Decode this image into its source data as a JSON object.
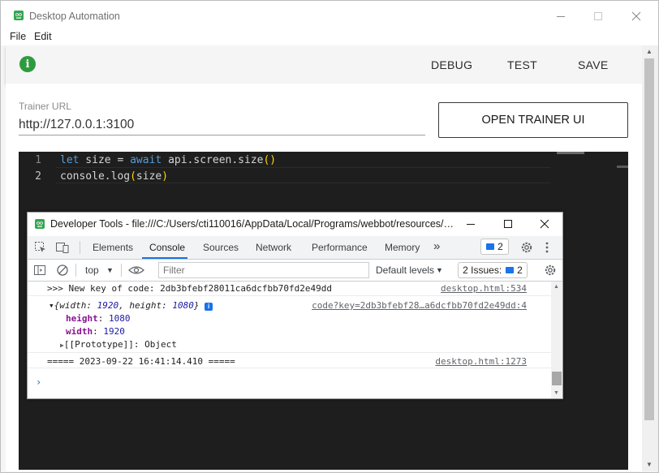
{
  "window": {
    "title": "Desktop Automation",
    "app_icon": "webbot-logo-icon",
    "controls": [
      "minimize-icon",
      "maximize-icon",
      "close-icon"
    ]
  },
  "menu": {
    "items": [
      "File",
      "Edit"
    ]
  },
  "toolbar": {
    "info_icon_glyph": "i",
    "debug_label": "DEBUG",
    "test_label": "TEST",
    "save_label": "SAVE"
  },
  "trainer": {
    "label": "Trainer URL",
    "url": "http://127.0.0.1:3100",
    "open_button": "OPEN TRAINER UI"
  },
  "editor": {
    "lines": [
      {
        "number": "1",
        "tokens": [
          {
            "text": "let",
            "kind": "kw"
          },
          {
            "text": " size = ",
            "kind": "plain"
          },
          {
            "text": "await",
            "kind": "kw"
          },
          {
            "text": " api.screen.size",
            "kind": "plain"
          },
          {
            "text": "()",
            "kind": "brace"
          }
        ]
      },
      {
        "number": "2",
        "tokens": [
          {
            "text": "console.log",
            "kind": "plain"
          },
          {
            "text": "(",
            "kind": "brace"
          },
          {
            "text": "size",
            "kind": "plain"
          },
          {
            "text": ")",
            "kind": "brace"
          }
        ]
      }
    ]
  },
  "devtools": {
    "title": "Developer Tools - file:///C:/Users/cti110016/AppData/Local/Programs/webbot/resources/ap...",
    "tabs": [
      "Elements",
      "Console",
      "Sources",
      "Network",
      "Performance",
      "Memory"
    ],
    "active_tab": "Console",
    "more_tabs_glyph": "»",
    "message_badge_count": "2",
    "context": "top",
    "filter_placeholder": "Filter",
    "levels": "Default levels",
    "issues_label": "2 Issues:",
    "issues_count": "2",
    "console": {
      "line1_text": ">>> New key of code: 2db3bfebf28011ca6dcfbb70fd2e49dd",
      "line1_src": "desktop.html:534",
      "obj_summary_prefix": "{width: ",
      "obj_width": "1920",
      "obj_mid": ", height: ",
      "obj_height": "1080",
      "obj_suffix": "}",
      "obj_info": "i",
      "obj_src": "code?key=2db3bfebf28…a6dcfbb70fd2e49dd:4",
      "prop_height_key": "height",
      "prop_height_val": "1080",
      "prop_width_key": "width",
      "prop_width_val": "1920",
      "prototype": "[[Prototype]]: Object",
      "line3_text": "===== 2023-09-22 16:41:14.410 =====",
      "line3_src": "desktop.html:1273",
      "prompt_glyph": "›"
    }
  },
  "colors": {
    "info_green": "#2e9c3e",
    "editor_bg": "#1e1e1e",
    "keyword_blue": "#569cd6",
    "brace_yellow": "#ffd700",
    "devtools_accent": "#1a73e8"
  }
}
